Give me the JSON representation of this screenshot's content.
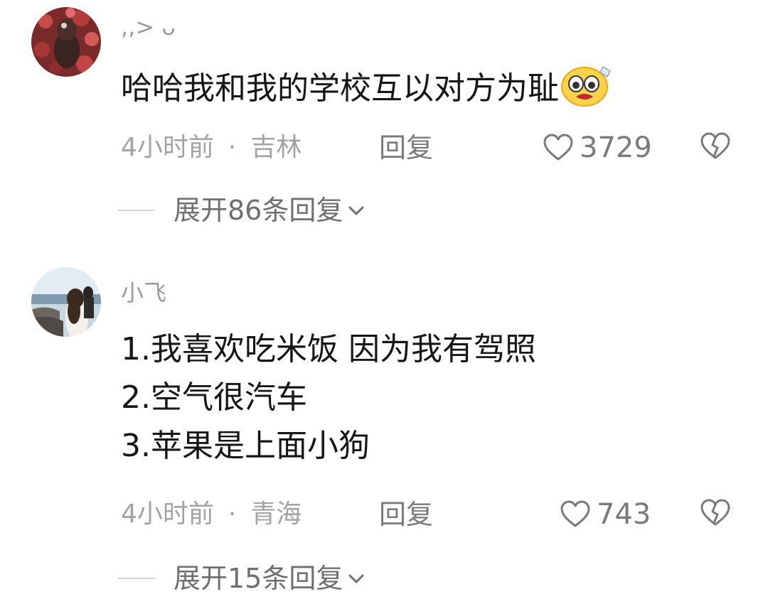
{
  "comments": [
    {
      "username": ",,> ᴗ",
      "lines": [
        "哈哈我和我的学校互以对方为耻"
      ],
      "time": "4小时前",
      "separator": "·",
      "location": "吉林",
      "reply_label": "回复",
      "likes": "3729",
      "expand_label": "展开86条回复"
    },
    {
      "username": "小飞",
      "lines": [
        "1.我喜欢吃米饭 因为我有驾照",
        "2.空气很汽车",
        "3.苹果是上面小狗"
      ],
      "time": "4小时前",
      "separator": "·",
      "location": "青海",
      "reply_label": "回复",
      "likes": "743",
      "expand_label": "展开15条回复"
    }
  ],
  "icons": {
    "like": "heart-outline-icon",
    "dislike": "broken-heart-icon",
    "expand": "chevron-down-icon",
    "emoji": "pleading-face-emoji"
  },
  "colors": {
    "text_primary": "#161616",
    "text_secondary": "#a3a3a3",
    "action_gray": "#7a7a7a"
  }
}
